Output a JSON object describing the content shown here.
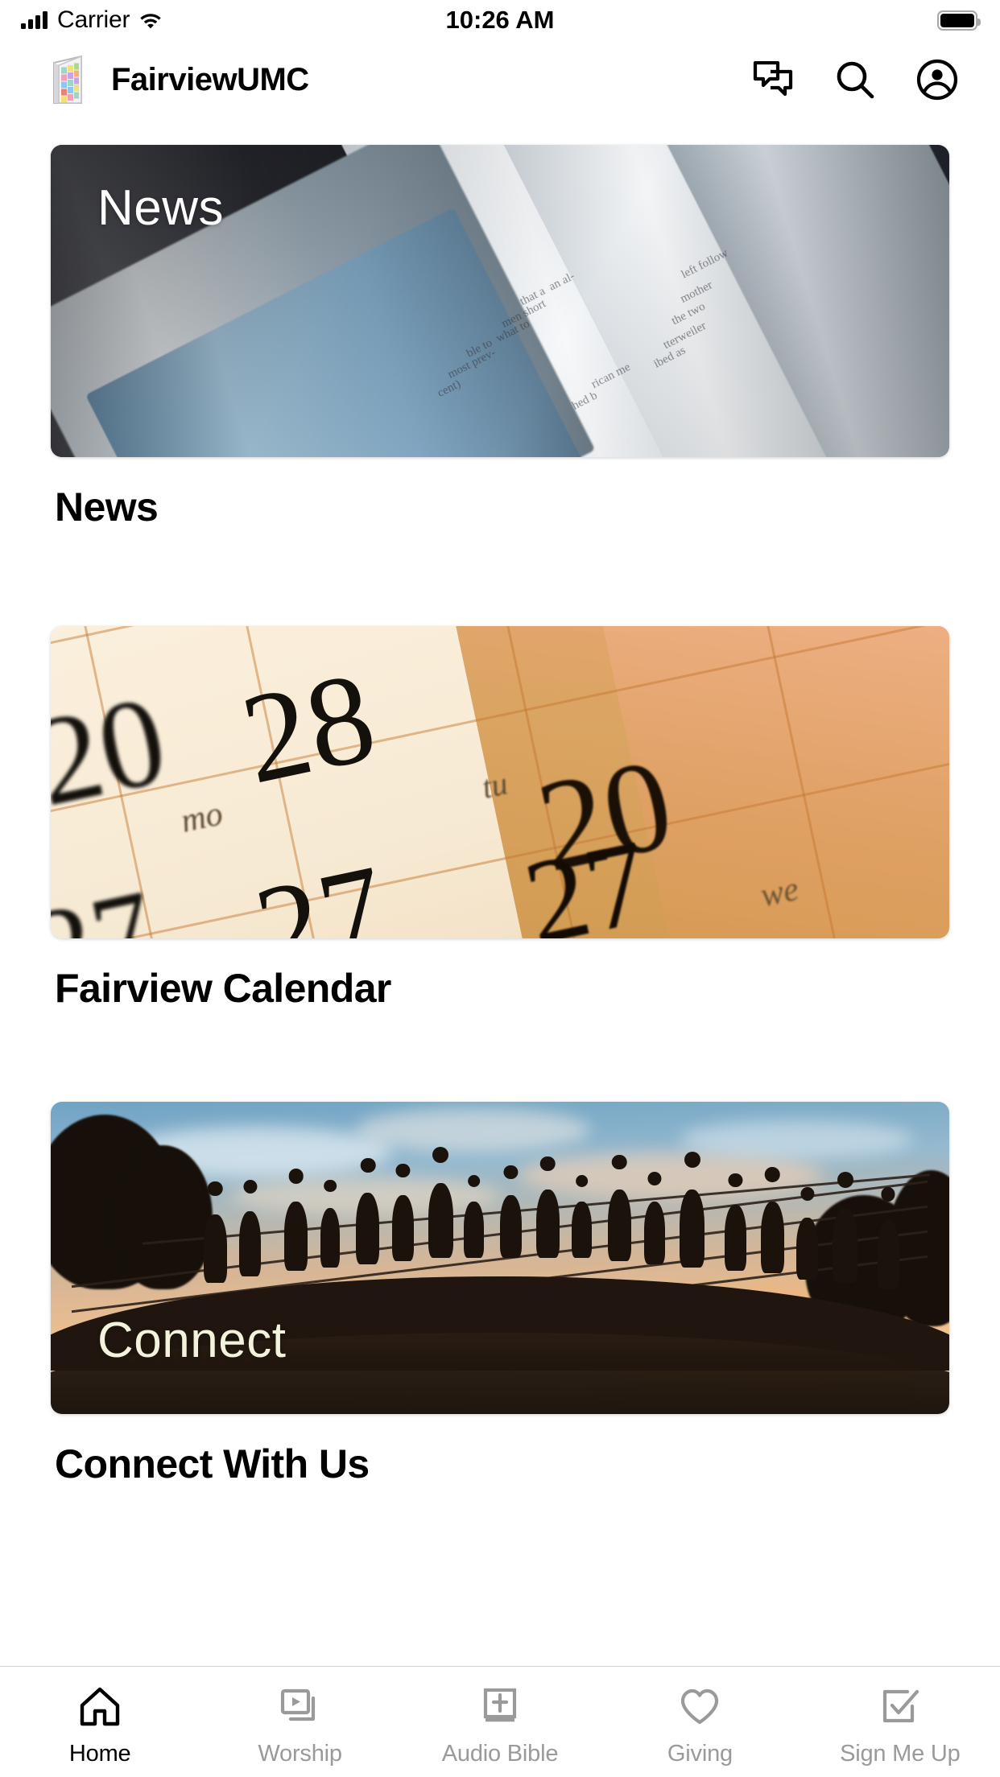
{
  "status_bar": {
    "carrier": "Carrier",
    "time": "10:26 AM",
    "signal_icon": "signal-bars-icon",
    "wifi_icon": "wifi-icon",
    "battery_icon": "battery-full-icon"
  },
  "header": {
    "logo_icon": "stained-glass-door-icon",
    "title": "FairviewUMC",
    "actions": [
      {
        "name": "chat-icon",
        "label": "Chat"
      },
      {
        "name": "search-icon",
        "label": "Search"
      },
      {
        "name": "account-circle-icon",
        "label": "Account"
      }
    ]
  },
  "main": {
    "cards": [
      {
        "id": "news",
        "overlay_label": "News",
        "title": "News",
        "image_alt": "folded newspapers close-up"
      },
      {
        "id": "fairview-calendar",
        "overlay_label": "",
        "title": "Fairview Calendar",
        "image_alt": "calendar page showing dates 20 27 28 with mo tu we"
      },
      {
        "id": "connect-with-us",
        "overlay_label": "Connect",
        "title": "Connect With Us",
        "image_alt": "silhouettes of people on a bridge at sunset"
      }
    ]
  },
  "calendar_art": {
    "numbers": [
      "20",
      "28",
      "27",
      "20",
      "27"
    ],
    "day_abbrevs": [
      "mo",
      "tu",
      "we",
      "mo",
      "tu"
    ]
  },
  "tab_bar": {
    "active_index": 0,
    "tabs": [
      {
        "label": "Home",
        "icon": "home-icon"
      },
      {
        "label": "Worship",
        "icon": "video-library-icon"
      },
      {
        "label": "Audio Bible",
        "icon": "bible-book-icon"
      },
      {
        "label": "Giving",
        "icon": "heart-outline-icon"
      },
      {
        "label": "Sign Me Up",
        "icon": "checkbox-edit-icon"
      }
    ]
  },
  "colors": {
    "active": "#000000",
    "inactive": "#9a9a9a",
    "background": "#ffffff",
    "divider": "#d2d2d4"
  }
}
